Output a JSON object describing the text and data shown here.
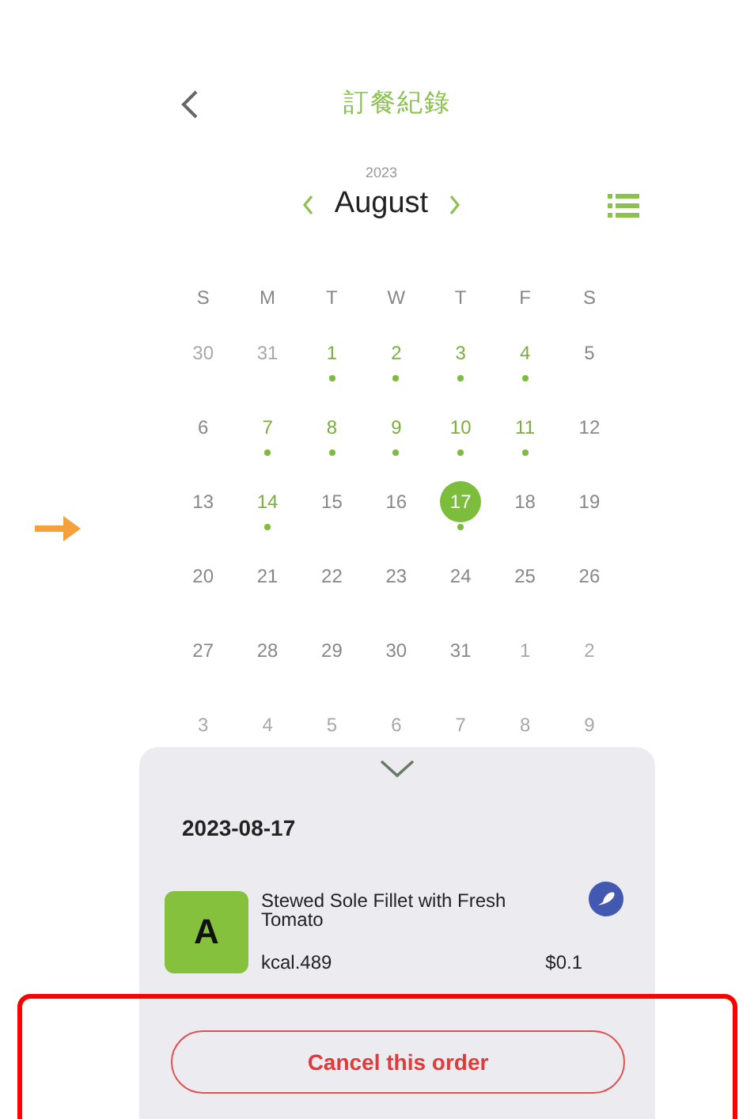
{
  "header": {
    "title": "訂餐紀錄"
  },
  "calendar": {
    "year": "2023",
    "month": "August",
    "weekdays": [
      "S",
      "M",
      "T",
      "W",
      "T",
      "F",
      "S"
    ],
    "days": [
      {
        "label": "30",
        "muted": true,
        "has_order": false,
        "selected": false
      },
      {
        "label": "31",
        "muted": true,
        "has_order": false,
        "selected": false
      },
      {
        "label": "1",
        "muted": false,
        "has_order": true,
        "selected": false
      },
      {
        "label": "2",
        "muted": false,
        "has_order": true,
        "selected": false
      },
      {
        "label": "3",
        "muted": false,
        "has_order": true,
        "selected": false
      },
      {
        "label": "4",
        "muted": false,
        "has_order": true,
        "selected": false
      },
      {
        "label": "5",
        "muted": false,
        "has_order": false,
        "selected": false
      },
      {
        "label": "6",
        "muted": false,
        "has_order": false,
        "selected": false
      },
      {
        "label": "7",
        "muted": false,
        "has_order": true,
        "selected": false
      },
      {
        "label": "8",
        "muted": false,
        "has_order": true,
        "selected": false
      },
      {
        "label": "9",
        "muted": false,
        "has_order": true,
        "selected": false
      },
      {
        "label": "10",
        "muted": false,
        "has_order": true,
        "selected": false
      },
      {
        "label": "11",
        "muted": false,
        "has_order": true,
        "selected": false
      },
      {
        "label": "12",
        "muted": false,
        "has_order": false,
        "selected": false
      },
      {
        "label": "13",
        "muted": false,
        "has_order": false,
        "selected": false
      },
      {
        "label": "14",
        "muted": false,
        "has_order": true,
        "selected": false
      },
      {
        "label": "15",
        "muted": false,
        "has_order": false,
        "selected": false
      },
      {
        "label": "16",
        "muted": false,
        "has_order": false,
        "selected": false
      },
      {
        "label": "17",
        "muted": false,
        "has_order": true,
        "selected": true
      },
      {
        "label": "18",
        "muted": false,
        "has_order": false,
        "selected": false
      },
      {
        "label": "19",
        "muted": false,
        "has_order": false,
        "selected": false
      },
      {
        "label": "20",
        "muted": false,
        "has_order": false,
        "selected": false
      },
      {
        "label": "21",
        "muted": false,
        "has_order": false,
        "selected": false
      },
      {
        "label": "22",
        "muted": false,
        "has_order": false,
        "selected": false
      },
      {
        "label": "23",
        "muted": false,
        "has_order": false,
        "selected": false
      },
      {
        "label": "24",
        "muted": false,
        "has_order": false,
        "selected": false
      },
      {
        "label": "25",
        "muted": false,
        "has_order": false,
        "selected": false
      },
      {
        "label": "26",
        "muted": false,
        "has_order": false,
        "selected": false
      },
      {
        "label": "27",
        "muted": false,
        "has_order": false,
        "selected": false
      },
      {
        "label": "28",
        "muted": false,
        "has_order": false,
        "selected": false
      },
      {
        "label": "29",
        "muted": false,
        "has_order": false,
        "selected": false
      },
      {
        "label": "30",
        "muted": false,
        "has_order": false,
        "selected": false
      },
      {
        "label": "31",
        "muted": false,
        "has_order": false,
        "selected": false
      },
      {
        "label": "1",
        "muted": true,
        "has_order": false,
        "selected": false
      },
      {
        "label": "2",
        "muted": true,
        "has_order": false,
        "selected": false
      },
      {
        "label": "3",
        "muted": true,
        "has_order": false,
        "selected": false
      },
      {
        "label": "4",
        "muted": true,
        "has_order": false,
        "selected": false
      },
      {
        "label": "5",
        "muted": true,
        "has_order": false,
        "selected": false
      },
      {
        "label": "6",
        "muted": true,
        "has_order": false,
        "selected": false
      },
      {
        "label": "7",
        "muted": true,
        "has_order": false,
        "selected": false
      },
      {
        "label": "8",
        "muted": true,
        "has_order": false,
        "selected": false
      },
      {
        "label": "9",
        "muted": true,
        "has_order": false,
        "selected": false
      }
    ]
  },
  "order": {
    "date": "2023-08-17",
    "items": [
      {
        "grade": "A",
        "name": "Stewed Sole Fillet with Fresh Tomato",
        "kcal": "kcal.489",
        "price": "$0.1"
      }
    ],
    "cancel_button": "Cancel this order"
  }
}
